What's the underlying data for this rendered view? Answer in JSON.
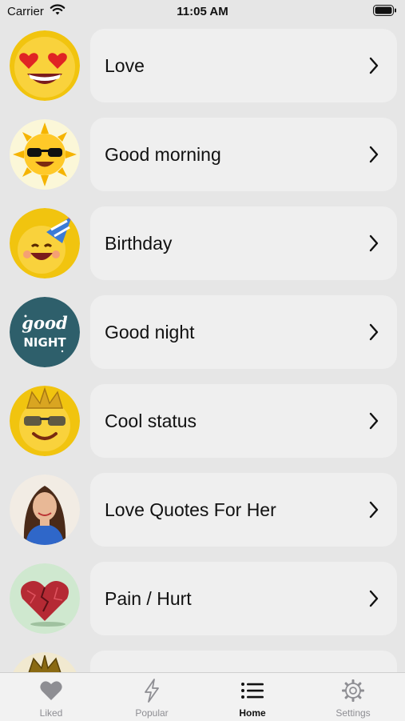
{
  "status_bar": {
    "carrier": "Carrier",
    "time": "11:05 AM"
  },
  "categories": [
    {
      "label": "Love",
      "icon": "heart-eyes-emoji-icon"
    },
    {
      "label": "Good morning",
      "icon": "sun-sunglasses-emoji-icon"
    },
    {
      "label": "Birthday",
      "icon": "party-hat-emoji-icon"
    },
    {
      "label": "Good night",
      "icon": "good-night-badge-icon",
      "badge_text_1": "good",
      "badge_text_2": "NIGHT"
    },
    {
      "label": "Cool status",
      "icon": "crown-sunglasses-emoji-icon"
    },
    {
      "label": "Love Quotes For Her",
      "icon": "woman-portrait-icon"
    },
    {
      "label": "Pain / Hurt",
      "icon": "broken-heart-icon"
    },
    {
      "label": "",
      "icon": "crown-emoji-icon"
    }
  ],
  "tabbar": {
    "tabs": [
      {
        "label": "Liked",
        "icon": "heart-icon"
      },
      {
        "label": "Popular",
        "icon": "lightning-icon"
      },
      {
        "label": "Home",
        "icon": "list-icon",
        "active": true
      },
      {
        "label": "Settings",
        "icon": "gear-icon"
      }
    ]
  },
  "colors": {
    "background": "#e6e6e6",
    "card": "#efefef",
    "accent": "#111111",
    "inactive": "#8e8e93"
  }
}
